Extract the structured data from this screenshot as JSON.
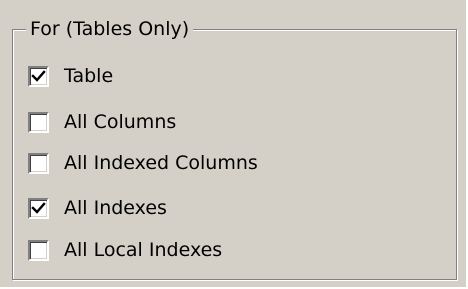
{
  "group": {
    "title": "For (Tables Only)",
    "options": [
      {
        "label": "Table",
        "checked": true
      },
      {
        "label": "All Columns",
        "checked": false
      },
      {
        "label": "All Indexed Columns",
        "checked": false
      },
      {
        "label": "All Indexes",
        "checked": true
      },
      {
        "label": "All Local Indexes",
        "checked": false
      }
    ]
  }
}
